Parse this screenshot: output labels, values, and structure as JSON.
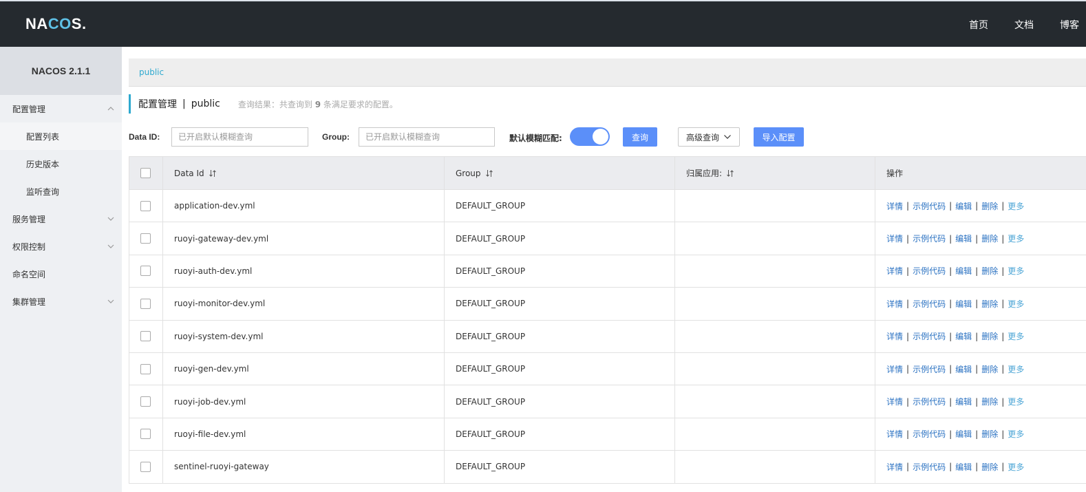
{
  "header": {
    "logo_pre": "NA",
    "logo_mid": "CO",
    "logo_post": "S.",
    "nav": [
      "首页",
      "文档",
      "博客"
    ]
  },
  "sidebar": {
    "version": "NACOS 2.1.1",
    "items": [
      {
        "label": "配置管理",
        "chevron": "up"
      },
      {
        "label": "配置列表",
        "sub": true,
        "active": true
      },
      {
        "label": "历史版本",
        "sub": true
      },
      {
        "label": "监听查询",
        "sub": true
      },
      {
        "label": "服务管理",
        "chevron": "down"
      },
      {
        "label": "权限控制",
        "chevron": "down"
      },
      {
        "label": "命名空间"
      },
      {
        "label": "集群管理",
        "chevron": "down"
      }
    ]
  },
  "namespace_bar": {
    "current": "public"
  },
  "title": {
    "main": "配置管理",
    "sep": "|",
    "namespace": "public",
    "hint_pre": "查询结果：共查询到",
    "hint_count": "9",
    "hint_post": "条满足要求的配置。"
  },
  "search": {
    "dataid_label": "Data ID:",
    "dataid_placeholder": "已开启默认模糊查询",
    "group_label": "Group:",
    "group_placeholder": "已开启默认模糊查询",
    "fuzzy_label": "默认模糊匹配:",
    "fuzzy_enabled": true,
    "query_button": "查询",
    "advanced_button": "高级查询",
    "import_button": "导入配置"
  },
  "table": {
    "columns": [
      "Data Id",
      "Group",
      "归属应用:",
      "操作"
    ],
    "rows": [
      {
        "data_id": "application-dev.yml",
        "group": "DEFAULT_GROUP",
        "app": ""
      },
      {
        "data_id": "ruoyi-gateway-dev.yml",
        "group": "DEFAULT_GROUP",
        "app": ""
      },
      {
        "data_id": "ruoyi-auth-dev.yml",
        "group": "DEFAULT_GROUP",
        "app": ""
      },
      {
        "data_id": "ruoyi-monitor-dev.yml",
        "group": "DEFAULT_GROUP",
        "app": ""
      },
      {
        "data_id": "ruoyi-system-dev.yml",
        "group": "DEFAULT_GROUP",
        "app": ""
      },
      {
        "data_id": "ruoyi-gen-dev.yml",
        "group": "DEFAULT_GROUP",
        "app": ""
      },
      {
        "data_id": "ruoyi-job-dev.yml",
        "group": "DEFAULT_GROUP",
        "app": ""
      },
      {
        "data_id": "ruoyi-file-dev.yml",
        "group": "DEFAULT_GROUP",
        "app": ""
      },
      {
        "data_id": "sentinel-ruoyi-gateway",
        "group": "DEFAULT_GROUP",
        "app": ""
      }
    ],
    "actions": [
      "详情",
      "示例代码",
      "编辑",
      "删除",
      "更多"
    ],
    "action_sep": "|"
  },
  "colors": {
    "header_bg": "#252a2f",
    "accent": "#2ea9cf",
    "primary": "#5b8ff9",
    "link": "#2b72c2"
  }
}
